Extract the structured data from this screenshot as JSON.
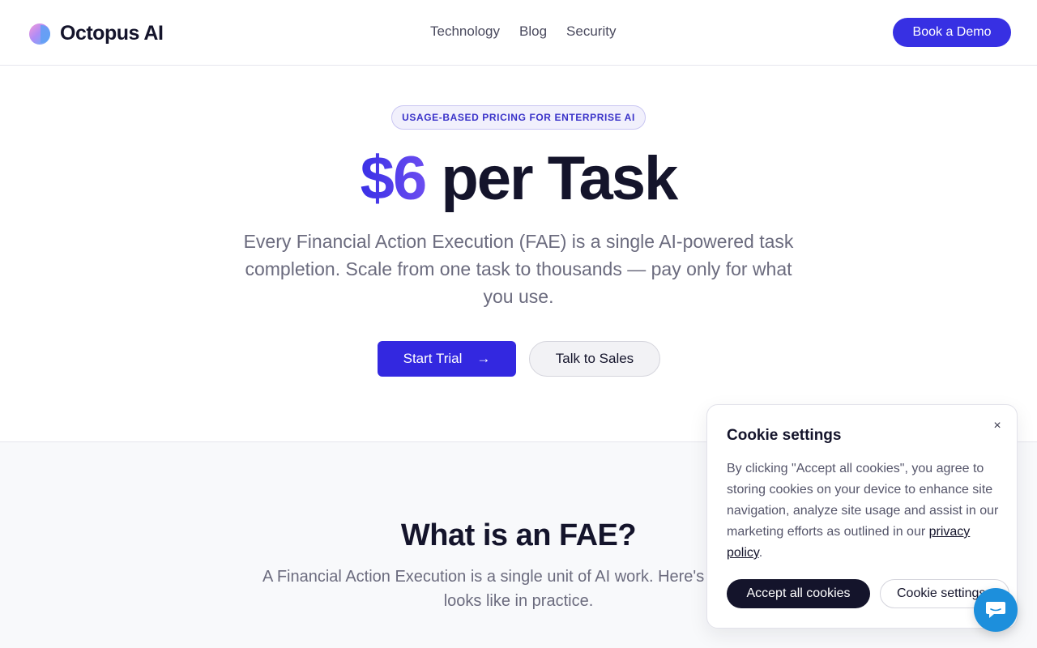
{
  "header": {
    "logo_text": "Octopus AI",
    "nav": [
      "Technology",
      "Blog",
      "Security"
    ],
    "demo_label": "Book a Demo"
  },
  "hero": {
    "badge": "USAGE-BASED PRICING FOR ENTERPRISE AI",
    "price": "$6",
    "title_rest": "per Task",
    "subtitle": "Every Financial Action Execution (FAE) is a single AI-powered task completion. Scale from one task to thousands — pay only for what you use.",
    "primary_label": "Start Trial",
    "primary_icon": "→",
    "secondary_label": "Talk to Sales"
  },
  "section2": {
    "title": "What is an FAE?",
    "text": "A Financial Action Execution is a single unit of AI work. Here's what that looks like in practice."
  },
  "cookie": {
    "title": "Cookie settings",
    "text_before": "By clicking \"Accept all cookies\", you agree to storing cookies on your device to enhance site navigation, analyze site usage and assist in our marketing efforts as outlined in our ",
    "link": "privacy policy",
    "text_after": ".",
    "close_icon": "×",
    "accept_label": "Accept all cookies",
    "settings_label": "Cookie settings"
  },
  "colors": {
    "accent": "#3328e0",
    "chat": "#1d8fdc"
  }
}
